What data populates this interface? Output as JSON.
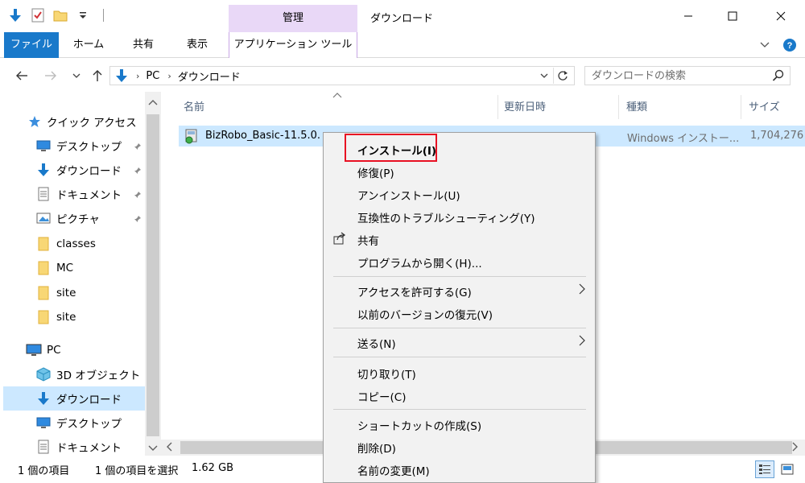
{
  "titlebar": {
    "manage_tab": "管理",
    "window_title": "ダウンロード"
  },
  "ribbon": {
    "file": "ファイル",
    "home": "ホーム",
    "share": "共有",
    "view": "表示",
    "app_tools": "アプリケーション ツール"
  },
  "address": {
    "crumbs": [
      "PC",
      "ダウンロード"
    ],
    "search_placeholder": "ダウンロードの検索"
  },
  "sidebar": {
    "items": [
      {
        "label": "クイック アクセス",
        "icon": "star-icon"
      },
      {
        "label": "デスクトップ",
        "icon": "desktop-icon",
        "pinned": true
      },
      {
        "label": "ダウンロード",
        "icon": "download-icon",
        "pinned": true
      },
      {
        "label": "ドキュメント",
        "icon": "document-icon",
        "pinned": true
      },
      {
        "label": "ピクチャ",
        "icon": "pictures-icon",
        "pinned": true
      },
      {
        "label": "classes",
        "icon": "folder-icon"
      },
      {
        "label": "MC",
        "icon": "folder-icon"
      },
      {
        "label": "site",
        "icon": "folder-icon"
      },
      {
        "label": "site",
        "icon": "folder-icon"
      },
      {
        "label": "PC",
        "icon": "pc-icon"
      },
      {
        "label": "3D オブジェクト",
        "icon": "3d-objects-icon"
      },
      {
        "label": "ダウンロード",
        "icon": "download-icon",
        "selected": true
      },
      {
        "label": "デスクトップ",
        "icon": "desktop-icon"
      },
      {
        "label": "ドキュメント",
        "icon": "document-icon"
      }
    ]
  },
  "columns": {
    "name": "名前",
    "modified": "更新日時",
    "type": "種類",
    "size": "サイズ"
  },
  "file": {
    "name": "BizRobo_Basic-11.5.0.",
    "type": "Windows インストー...",
    "size": "1,704,276"
  },
  "status": {
    "count": "1 個の項目",
    "selected": "1 個の項目を選択",
    "size": "1.62 GB"
  },
  "context_menu": {
    "install": "インストール(I)",
    "repair": "修復(P)",
    "uninstall": "アンインストール(U)",
    "troubleshoot": "互換性のトラブルシューティング(Y)",
    "share": "共有",
    "open_with": "プログラムから開く(H)...",
    "grant_access": "アクセスを許可する(G)",
    "restore_previous": "以前のバージョンの復元(V)",
    "send_to": "送る(N)",
    "cut": "切り取り(T)",
    "copy": "コピー(C)",
    "create_shortcut": "ショートカットの作成(S)",
    "delete": "削除(D)",
    "rename": "名前の変更(M)"
  },
  "colors": {
    "accent": "#1979ca",
    "selection": "#cce8ff",
    "app_tools_tab": "#e9d8f7",
    "highlight": "#e81123"
  }
}
